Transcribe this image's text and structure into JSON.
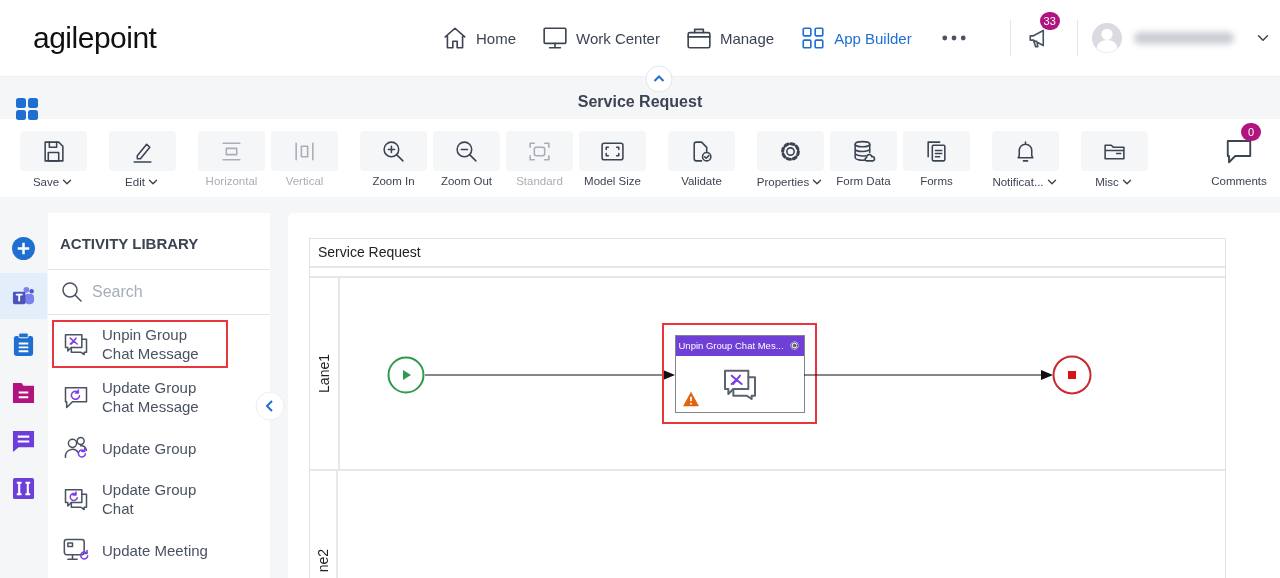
{
  "header": {
    "logo": "agilepoint",
    "nav": [
      {
        "label": "Home",
        "selected": false
      },
      {
        "label": "Work Center",
        "selected": false
      },
      {
        "label": "Manage",
        "selected": false
      },
      {
        "label": "App Builder",
        "selected": true
      }
    ],
    "notification_count": "33"
  },
  "subheader": {
    "title": "Service Request"
  },
  "toolbar_groups": [
    [
      {
        "label": "Save",
        "disabled": false,
        "dropdown": true
      }
    ],
    [
      {
        "label": "Edit",
        "disabled": false,
        "dropdown": true
      }
    ],
    [
      {
        "label": "Horizontal",
        "disabled": true,
        "dropdown": false
      },
      {
        "label": "Vertical",
        "disabled": true,
        "dropdown": false
      }
    ],
    [
      {
        "label": "Zoom In",
        "disabled": false,
        "dropdown": false
      },
      {
        "label": "Zoom Out",
        "disabled": false,
        "dropdown": false
      },
      {
        "label": "Standard",
        "disabled": true,
        "dropdown": false
      },
      {
        "label": "Model Size",
        "disabled": false,
        "dropdown": false
      }
    ],
    [
      {
        "label": "Validate",
        "disabled": false,
        "dropdown": false
      }
    ],
    [
      {
        "label": "Properties",
        "disabled": false,
        "dropdown": true
      },
      {
        "label": "Form Data",
        "disabled": false,
        "dropdown": false
      },
      {
        "label": "Forms",
        "disabled": false,
        "dropdown": false
      }
    ],
    [
      {
        "label": "Notificat...",
        "disabled": false,
        "dropdown": true
      }
    ],
    [
      {
        "label": "Misc",
        "disabled": false,
        "dropdown": true
      }
    ]
  ],
  "comments": {
    "label": "Comments",
    "count": "0"
  },
  "rail": [
    {
      "selected": false
    },
    {
      "selected": true
    },
    {
      "selected": false
    },
    {
      "selected": false
    },
    {
      "selected": false
    },
    {
      "selected": false
    }
  ],
  "library": {
    "title": "ACTIVITY LIBRARY",
    "search": {
      "placeholder": "Search"
    },
    "items": [
      {
        "label": "Unpin Group Chat Message",
        "highlighted": true
      },
      {
        "label": "Update Group Chat Message",
        "highlighted": false
      },
      {
        "label": "Update Group",
        "highlighted": false
      },
      {
        "label": "Update Group Chat",
        "highlighted": false
      },
      {
        "label": "Update Meeting",
        "highlighted": false
      }
    ]
  },
  "process": {
    "title": "Service Request",
    "lanes": [
      {
        "label": "Lane1"
      },
      {
        "label": "ne2"
      }
    ],
    "activity": {
      "title": "Unpin Group Chat Mes...",
      "warning": true,
      "selected": true
    }
  }
}
